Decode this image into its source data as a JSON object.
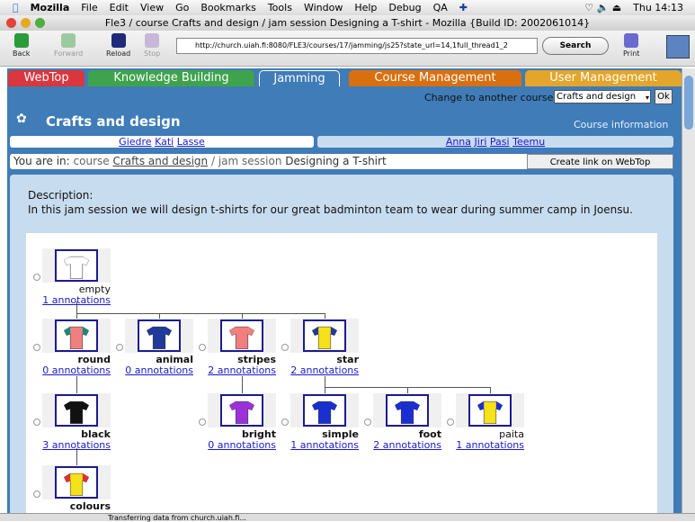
{
  "menubar": {
    "app": "Mozilla",
    "items": [
      "File",
      "Edit",
      "View",
      "Go",
      "Bookmarks",
      "Tools",
      "Window",
      "Help",
      "Debug",
      "QA"
    ],
    "clock": "Thu 14:13"
  },
  "window": {
    "title": "Fle3 / course Crafts and design / jam session Designing a T-shirt - Mozilla {Build ID: 2002061014}"
  },
  "toolbar": {
    "back": "Back",
    "forward": "Forward",
    "reload": "Reload",
    "stop": "Stop",
    "url": "http://church.uiah.fi:8080/FLE3/courses/17/jamming/js25?state_url=14,1full_thread1_2",
    "search": "Search",
    "print": "Print"
  },
  "tabs": [
    {
      "label": "WebTop",
      "color": "#d9363e"
    },
    {
      "label": "Knowledge Building",
      "color": "#3fa34d"
    },
    {
      "label": "Jamming",
      "color": "#3f7cb8"
    },
    {
      "label": "Course Management",
      "color": "#d9700f"
    },
    {
      "label": "User Management",
      "color": "#e3a52a"
    }
  ],
  "course_switch": {
    "label": "Change to another course",
    "selected": "Crafts and design",
    "ok": "Ok"
  },
  "course": {
    "title": "Crafts and design",
    "info_link": "Course information"
  },
  "groups": [
    [
      "Giedre",
      "Kati",
      "Lasse"
    ],
    [
      "Anna",
      "Jiri",
      "Pasi",
      "Teemu"
    ]
  ],
  "breadcrumb": {
    "prefix": "You are in:",
    "course_word": "course",
    "course": "Crafts and design",
    "sep": "/",
    "session_word": "jam session",
    "session": "Designing a T-shirt",
    "create_link": "Create link on WebTop"
  },
  "description": {
    "label": "Description:",
    "text": "In this jam session we will design t-shirts for our great badminton team to wear during summer camp in Joensu."
  },
  "artefacts": [
    {
      "name": "empty",
      "annotations": "1 annotations",
      "body": "#ffffff",
      "sleeve": "#ffffff"
    },
    {
      "name": "round",
      "annotations": "0 annotations",
      "body": "#f08080",
      "sleeve": "#1a8a7a"
    },
    {
      "name": "animal",
      "annotations": "0 annotations",
      "body": "#1f3a9a",
      "sleeve": "#1f3a9a"
    },
    {
      "name": "stripes",
      "annotations": "2 annotations",
      "body": "#f08080",
      "sleeve": "#f08080"
    },
    {
      "name": "star",
      "annotations": "2 annotations",
      "body": "#f5e21a",
      "sleeve": "#1f3aa0"
    },
    {
      "name": "black",
      "annotations": "3 annotations",
      "body": "#111111",
      "sleeve": "#111111"
    },
    {
      "name": "bright",
      "annotations": "0 annotations",
      "body": "#9a32d8",
      "sleeve": "#9a32d8"
    },
    {
      "name": "simple",
      "annotations": "1 annotations",
      "body": "#1a2fd0",
      "sleeve": "#1a2fd0"
    },
    {
      "name": "foot",
      "annotations": "2 annotations",
      "body": "#1a2fd0",
      "sleeve": "#1a2fd0"
    },
    {
      "name": "paita",
      "annotations": "1 annotations",
      "body": "#f5e21a",
      "sleeve": "#1a2fd0"
    },
    {
      "name": "colours",
      "annotations": "",
      "body": "#f5e21a",
      "sleeve": "#e03030"
    }
  ],
  "status": {
    "text": "Transferring data from church.uiah.fi..."
  }
}
